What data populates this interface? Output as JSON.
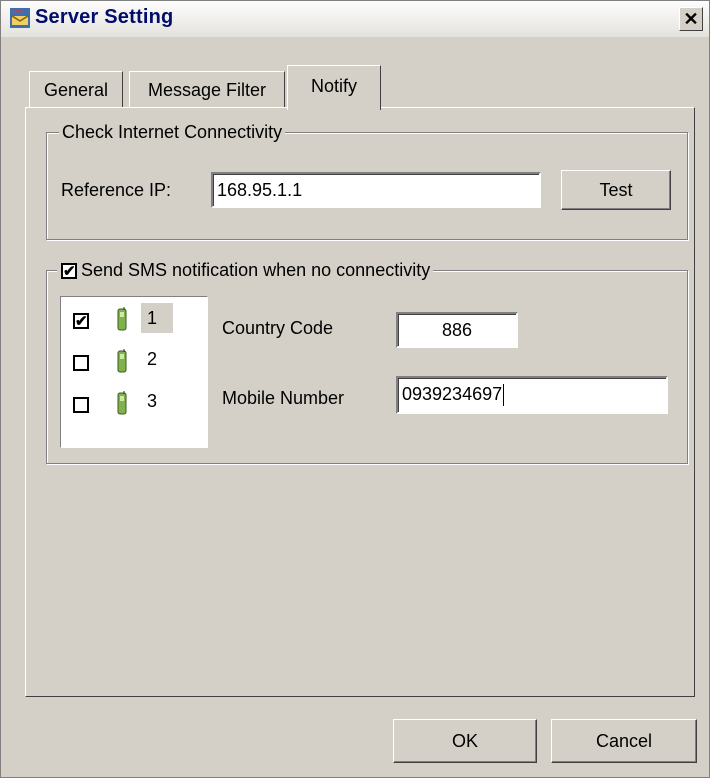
{
  "window": {
    "title": "Server Setting",
    "close_glyph": "✕"
  },
  "tabs": [
    {
      "label": "General"
    },
    {
      "label": "Message Filter"
    },
    {
      "label": "Notify"
    }
  ],
  "connectivity": {
    "legend": "Check Internet Connectivity",
    "ref_label": "Reference IP:",
    "ref_value": "168.95.1.1",
    "test_label": "Test"
  },
  "sms": {
    "legend": "Send SMS notification when no connectivity",
    "enabled": true,
    "phones": [
      {
        "label": "1",
        "checked": true
      },
      {
        "label": "2",
        "checked": false
      },
      {
        "label": "3",
        "checked": false
      }
    ],
    "country_label": "Country Code",
    "country_value": "886",
    "mobile_label": "Mobile Number",
    "mobile_value": "0939234697"
  },
  "buttons": {
    "ok": "OK",
    "cancel": "Cancel"
  },
  "icons": {
    "app": "sms-app-icon",
    "phone": "mobile-phone-icon",
    "check": "✔"
  },
  "colors": {
    "face": "#d4d0c8",
    "title_text": "#000d6a",
    "phone_green": "#7fb24a"
  }
}
